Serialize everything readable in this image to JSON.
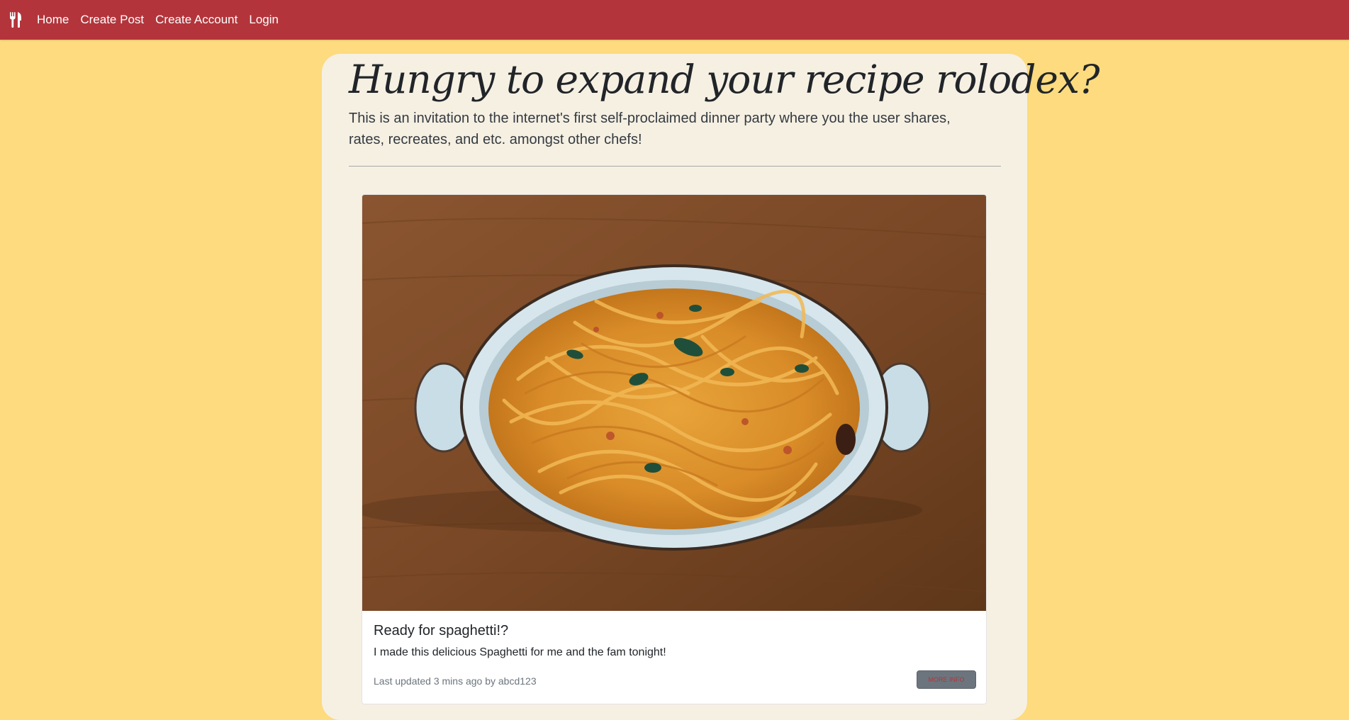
{
  "navbar": {
    "brand_icon": "utensils-icon",
    "links": [
      "Home",
      "Create Post",
      "Create Account",
      "Login"
    ],
    "background": "#b3353b"
  },
  "hero": {
    "title": "Hungry to expand your recipe rolodex?",
    "lead": "This is an invitation to the internet's first self-proclaimed dinner party where you the user shares, rates, recreates, and etc. amongst other chefs!"
  },
  "post": {
    "image_icon": "spaghetti-photo",
    "title": "Ready for spaghetti!?",
    "text": "I made this delicious Spaghetti for me and the fam tonight!",
    "meta": "Last updated 3 mins ago by abcd123",
    "button_label": "MORE INFO"
  },
  "colors": {
    "page_background": "#fddb7e",
    "panel_background": "#f6f0e3",
    "accent": "#b3353b"
  }
}
